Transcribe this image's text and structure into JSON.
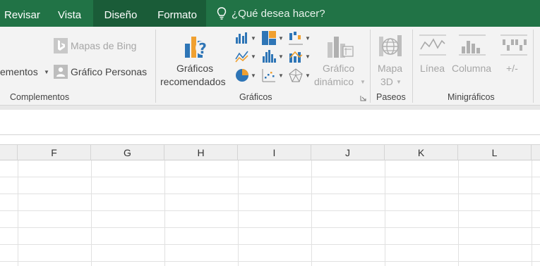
{
  "tabs": {
    "revisar": "Revisar",
    "vista": "Vista",
    "diseno": "Diseño",
    "formato": "Formato"
  },
  "tell_me": "¿Qué desea hacer?",
  "ribbon": {
    "complementos": {
      "mis_complementos_partial": "ementos",
      "bing_maps": "Mapas de Bing",
      "people_graph": "Gráfico Personas",
      "label": "Complementos"
    },
    "graficos": {
      "recommended_line1": "Gráficos",
      "recommended_line2": "recomendados",
      "pivot_line1": "Gráfico",
      "pivot_line2": "dinámico",
      "label": "Gráficos"
    },
    "paseos": {
      "map3d_line1": "Mapa",
      "map3d_line2": "3D",
      "label": "Paseos"
    },
    "minigraficos": {
      "line": "Línea",
      "column": "Columna",
      "winloss": "+/-",
      "label": "Minigráficos"
    }
  },
  "columns": [
    "F",
    "G",
    "H",
    "I",
    "J",
    "K",
    "L"
  ],
  "colors": {
    "tabbar": "#217346",
    "active_tab": "#1a5c38",
    "accent_blue": "#2e75b6",
    "accent_orange": "#f0a030"
  }
}
